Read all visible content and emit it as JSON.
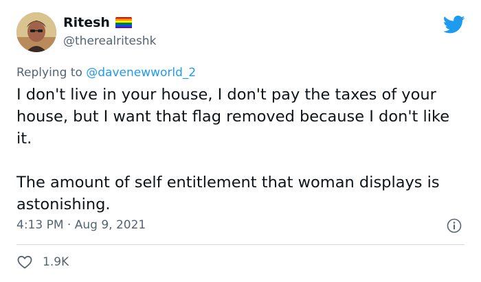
{
  "tweet": {
    "author": {
      "display_name": "Ritesh",
      "handle": "@therealriteshk",
      "badge_icon": "rainbow-flag-icon",
      "flag_colors": [
        "#e40303",
        "#ff8c00",
        "#ffed00",
        "#008026",
        "#004dff",
        "#750787"
      ]
    },
    "brand_icon": "twitter-bird-icon",
    "brand_color": "#1d9bf0",
    "reply": {
      "prefix": "Replying to",
      "mention": "@davenewworld_2"
    },
    "text": {
      "paragraph_1": "I don't live in your house, I don't pay the taxes of your house, but I want that flag removed because I don't like it.",
      "paragraph_2": "The amount of self entitlement that woman displays is astonishing."
    },
    "time": "4:13 PM",
    "separator": "·",
    "date": "Aug 9, 2021",
    "info_icon": "info-icon",
    "likes": {
      "icon": "heart-icon",
      "count": "1.9K"
    }
  }
}
